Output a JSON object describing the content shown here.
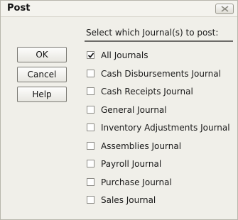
{
  "dialog": {
    "title": "Post",
    "prompt": "Select which Journal(s) to post:"
  },
  "buttons": {
    "ok": "OK",
    "cancel": "Cancel",
    "help": "Help"
  },
  "journals": [
    {
      "label": "All Journals",
      "checked": true
    },
    {
      "label": "Cash Disbursements Journal",
      "checked": false
    },
    {
      "label": "Cash Receipts Journal",
      "checked": false
    },
    {
      "label": "General Journal",
      "checked": false
    },
    {
      "label": "Inventory Adjustments Journal",
      "checked": false
    },
    {
      "label": "Assemblies Journal",
      "checked": false
    },
    {
      "label": "Payroll Journal",
      "checked": false
    },
    {
      "label": "Purchase Journal",
      "checked": false
    },
    {
      "label": "Sales Journal",
      "checked": false
    }
  ],
  "icons": {
    "close": "close-icon",
    "check": "checkmark-icon"
  }
}
